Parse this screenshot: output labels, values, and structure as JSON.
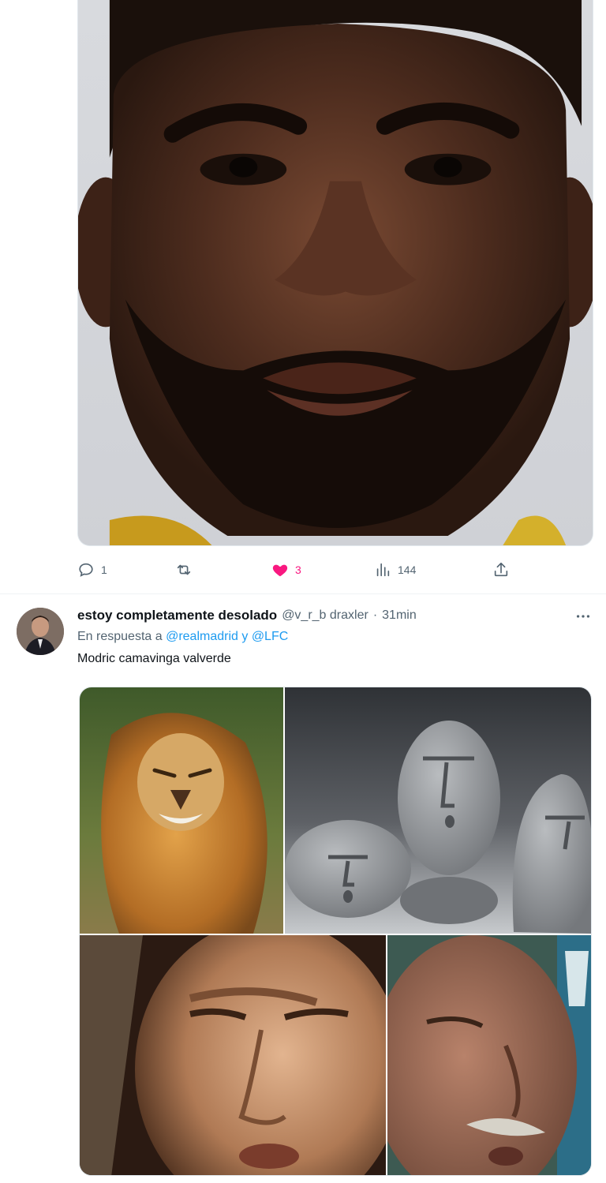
{
  "tweet1": {
    "media_alt": "portrait photo",
    "actions": {
      "reply_count": "1",
      "retweet_count": "",
      "like_count": "3",
      "views_count": "144"
    },
    "colors": {
      "like": "#f91880",
      "icon": "#536471"
    }
  },
  "tweet2": {
    "display_name": "estoy completamente desolado",
    "handle": "@v_r_b draxler",
    "separator": "·",
    "time": "31min",
    "more_icon": "more-horizontal-icon",
    "reply_prefix": "En respuesta a",
    "mention1": "@realmadrid",
    "reply_join": "y",
    "mention2": "@LFC",
    "text": "Modric camavinga valverde",
    "media": [
      "lion-image",
      "stone-faces-image",
      "squinting-man-image",
      "old-man-image"
    ]
  },
  "theme": {
    "accent": "#1d9bf0",
    "muted": "#536471",
    "text": "#0f1419"
  }
}
